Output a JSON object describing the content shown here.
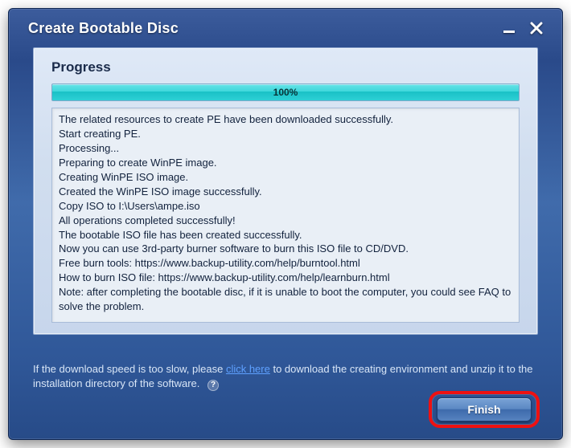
{
  "window": {
    "title": "Create Bootable Disc"
  },
  "icons": {
    "minimize": "minimize",
    "close": "close"
  },
  "panel": {
    "heading": "Progress",
    "progress_percent": "100%",
    "log_lines": [
      "The related resources to create PE have been downloaded successfully.",
      "Start creating PE.",
      "Processing...",
      "Preparing to create WinPE image.",
      "Creating WinPE ISO image.",
      "Created the WinPE ISO image successfully.",
      "Copy ISO to I:\\Users\\ampe.iso",
      "All operations completed successfully!",
      "The bootable ISO file has been created successfully.",
      "Now you can use 3rd-party burner software to burn this ISO file to CD/DVD.",
      "Free burn tools: https://www.backup-utility.com/help/burntool.html",
      "How to burn ISO file: https://www.backup-utility.com/help/learnburn.html",
      "Note: after completing the bootable disc, if it is unable to boot the computer, you could see FAQ to solve the problem."
    ]
  },
  "hint": {
    "pre": "If the download speed is too slow, please ",
    "link": "click here",
    "post": " to download the creating environment and unzip it to the installation directory of the software.",
    "help": "?"
  },
  "footer": {
    "finish_label": "Finish"
  }
}
